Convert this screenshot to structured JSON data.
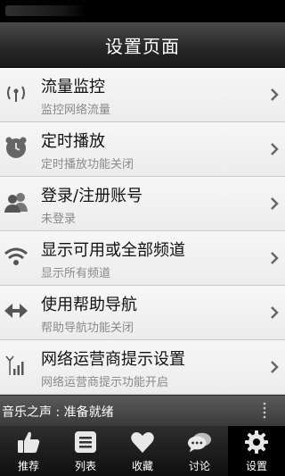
{
  "header": {
    "title": "设置页面"
  },
  "settings": [
    {
      "label": "流量监控",
      "sub": "监控网络流量",
      "icon": "antenna-icon"
    },
    {
      "label": "定时播放",
      "sub": "定时播放功能关闭",
      "icon": "clock-icon"
    },
    {
      "label": "登录/注册账号",
      "sub": "未登录",
      "icon": "users-icon"
    },
    {
      "label": "显示可用或全部频道",
      "sub": "显示所有频道",
      "icon": "wifi-icon"
    },
    {
      "label": "使用帮助导航",
      "sub": "帮助导航功能关闭",
      "icon": "arrows-icon"
    },
    {
      "label": "网络运营商提示设置",
      "sub": "网络运营商提示功能开启",
      "icon": "signal-icon"
    }
  ],
  "player": {
    "status": "音乐之声 : 准备就绪"
  },
  "tabs": [
    {
      "label": "推荐",
      "icon": "thumbs-up-icon"
    },
    {
      "label": "列表",
      "icon": "list-icon"
    },
    {
      "label": "收藏",
      "icon": "heart-icon"
    },
    {
      "label": "讨论",
      "icon": "chat-icon"
    },
    {
      "label": "设置",
      "icon": "gear-icon",
      "active": true
    }
  ],
  "colors": {
    "title_bar": "#262626",
    "list_bg": "#f0f0f0",
    "tab_bar": "#1a1a1a",
    "subtext": "#8a8a8a"
  }
}
